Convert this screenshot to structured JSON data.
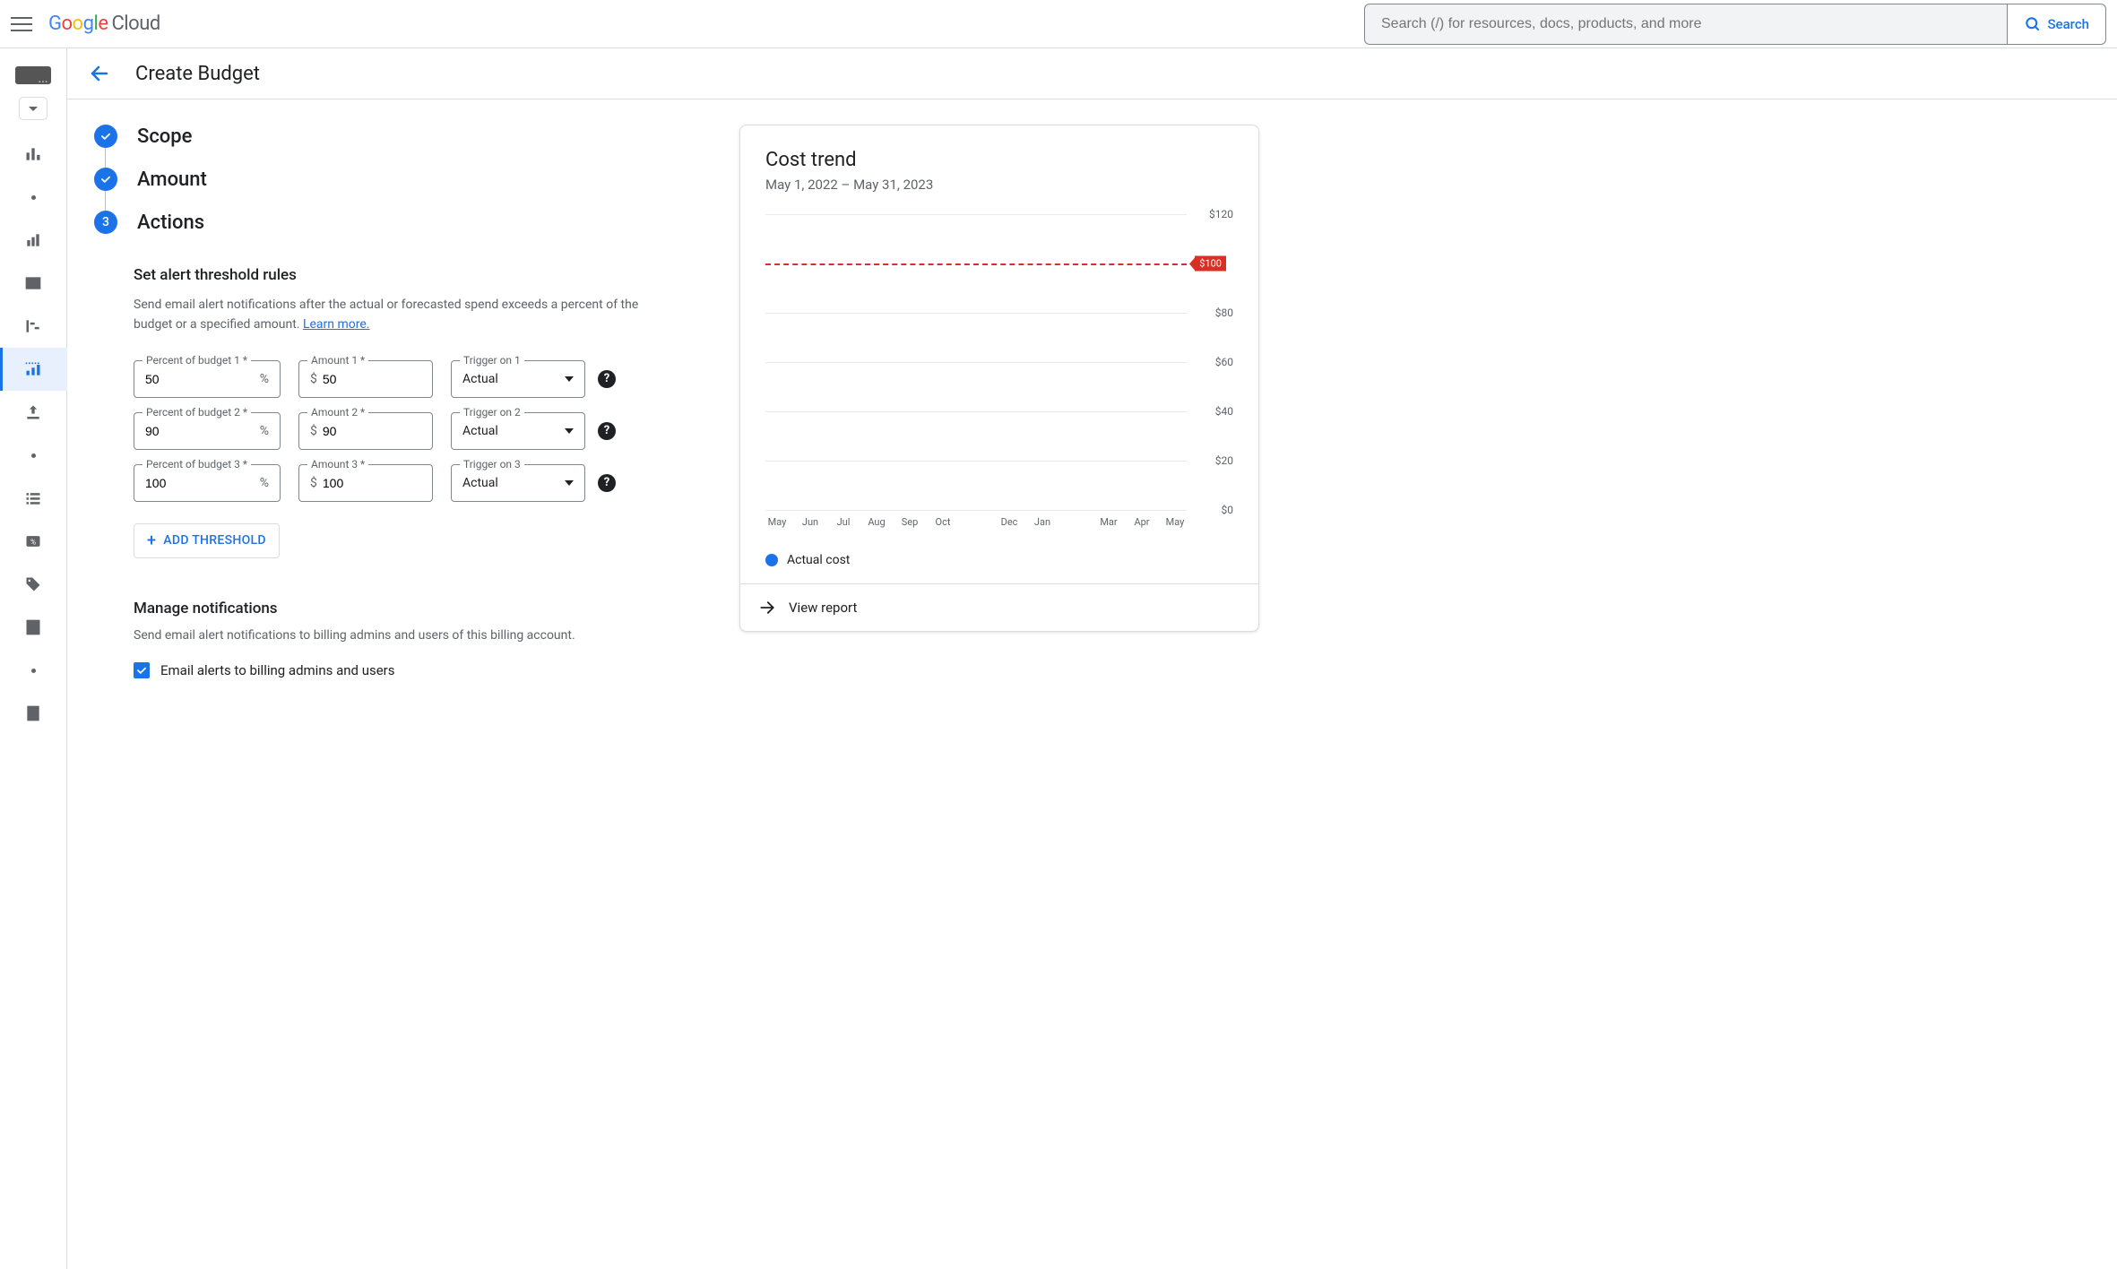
{
  "header": {
    "logo_cloud": "Cloud",
    "search_placeholder": "Search (/) for resources, docs, products, and more",
    "search_button": "Search"
  },
  "page": {
    "title": "Create Budget"
  },
  "steps": {
    "scope": "Scope",
    "amount": "Amount",
    "actions": "Actions",
    "actions_num": "3"
  },
  "alerts": {
    "heading": "Set alert threshold rules",
    "desc_a": "Send email alert notifications after the actual or forecasted spend exceeds a percent of the budget or a specified amount. ",
    "learn_more": "Learn more.",
    "labels": {
      "percent1": "Percent of budget 1 *",
      "percent2": "Percent of budget 2 *",
      "percent3": "Percent of budget 3 *",
      "amount1": "Amount 1 *",
      "amount2": "Amount 2 *",
      "amount3": "Amount 3 *",
      "trigger1": "Trigger on 1",
      "trigger2": "Trigger on 2",
      "trigger3": "Trigger on 3"
    },
    "rows": [
      {
        "percent": "50",
        "amount": "50",
        "trigger": "Actual"
      },
      {
        "percent": "90",
        "amount": "90",
        "trigger": "Actual"
      },
      {
        "percent": "100",
        "amount": "100",
        "trigger": "Actual"
      }
    ],
    "add_button": "ADD THRESHOLD"
  },
  "notifications": {
    "heading": "Manage notifications",
    "desc": "Send email alert notifications to billing admins and users of this billing account.",
    "checkbox_label": "Email alerts to billing admins and users"
  },
  "cost_card": {
    "title": "Cost trend",
    "range": "May 1, 2022 – May 31, 2023",
    "budget_tag": "$100",
    "legend": "Actual cost",
    "view_report": "View report"
  },
  "chart_data": {
    "type": "bar",
    "title": "Cost trend",
    "xlabel": "",
    "ylabel": "",
    "ylim": [
      0,
      120
    ],
    "y_ticks": [
      0,
      20,
      40,
      60,
      80,
      120
    ],
    "budget_line": 100,
    "categories": [
      "May",
      "Jun",
      "Jul",
      "Aug",
      "Sep",
      "Oct",
      "",
      "Dec",
      "Jan",
      "",
      "Mar",
      "Apr",
      "May"
    ],
    "series": [
      {
        "name": "Actual cost",
        "values": [
          0,
          0,
          0,
          0,
          0,
          0,
          0,
          0,
          0,
          0,
          0,
          0,
          0
        ]
      }
    ]
  }
}
